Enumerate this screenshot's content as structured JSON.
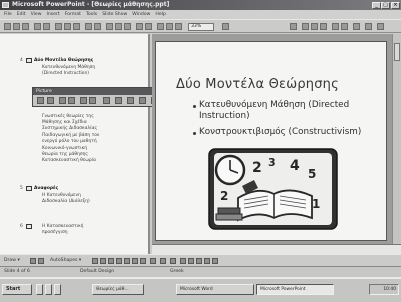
{
  "window": {
    "title": "Microsoft PowerPoint - [Θεωρίες μάθησης.ppt]"
  },
  "menu": [
    "File",
    "Edit",
    "View",
    "Insert",
    "Format",
    "Tools",
    "Slide Show",
    "Window",
    "Help"
  ],
  "toolbar": {
    "zoom": "33%"
  },
  "floating_toolbar": {
    "title": "Picture"
  },
  "outline": {
    "slide4_number": "4",
    "slide4_title": "Δύο Μοντέλα Θεώρησης",
    "slide4_line1": "Κατευθυνόμενη Μάθηση",
    "slide4_line2": "(Directed Instruction)",
    "body_lines": [
      "Γνωστικές θεωρίες της",
      "Μάθησης και Σχέδια",
      "Συστημικής Διδασκαλίας",
      "Παιδαγωγική με βάση τον",
      "ενεργό ρόλο του μαθητή",
      "Κοινωνικό-γνωστική",
      "θεωρία της μάθησης",
      "Κατασκευαστική θεωρία"
    ],
    "slide5_number": "5",
    "slide5_title": "Αναφορές",
    "slide5_lines": [
      "Η Κατευθυνόμενη",
      "Διδασκαλία (Διάλεξη)"
    ],
    "slide6_number": "6",
    "slide6_lines": [
      "Η Κατασκευαστική",
      "προσέγγιση"
    ]
  },
  "slide": {
    "title": "Δύο Μοντέλα Θεώρησης",
    "bullets": [
      "Κατευθυνόμενη Μάθηση (Directed Instruction)",
      "Κονστρουκτιβισμός (Constructivism)"
    ],
    "clipart_name": "books-and-clock"
  },
  "drawbar": {
    "draw_label": "Draw ▾",
    "autoshapes_label": "AutoShapes ▾"
  },
  "status": {
    "slide": "Slide 4 of 6",
    "design": "Default Design",
    "language": "Greek"
  },
  "taskbar": {
    "start": "Start",
    "tasks": [
      "Θεωρίες μάθ...",
      "Microsoft Word",
      "Microsoft PowerPoint"
    ],
    "clock": "10:40"
  }
}
